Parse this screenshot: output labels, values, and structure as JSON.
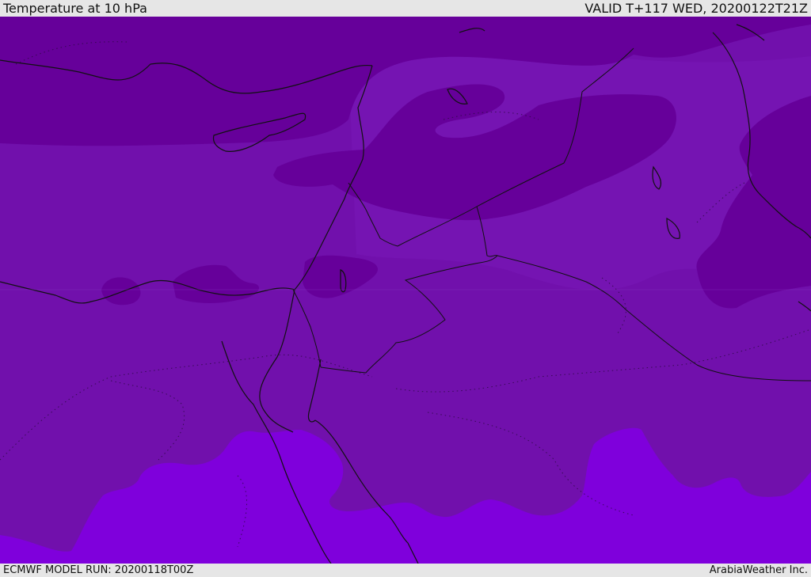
{
  "header": {
    "title": "Temperature at 10 hPa",
    "valid_time": "VALID T+117 WED, 20200122T21Z"
  },
  "footer": {
    "model_run": "ECMWF MODEL RUN: 20200118T00Z",
    "credit": "ArabiaWeather Inc."
  },
  "colors": {
    "coldest_band": "#66009a",
    "mid_band": "#7110ac",
    "warm_band": "#7a14b6",
    "warmest_band": "#7f00dc",
    "coastline": "#111111",
    "border": "#111111"
  }
}
